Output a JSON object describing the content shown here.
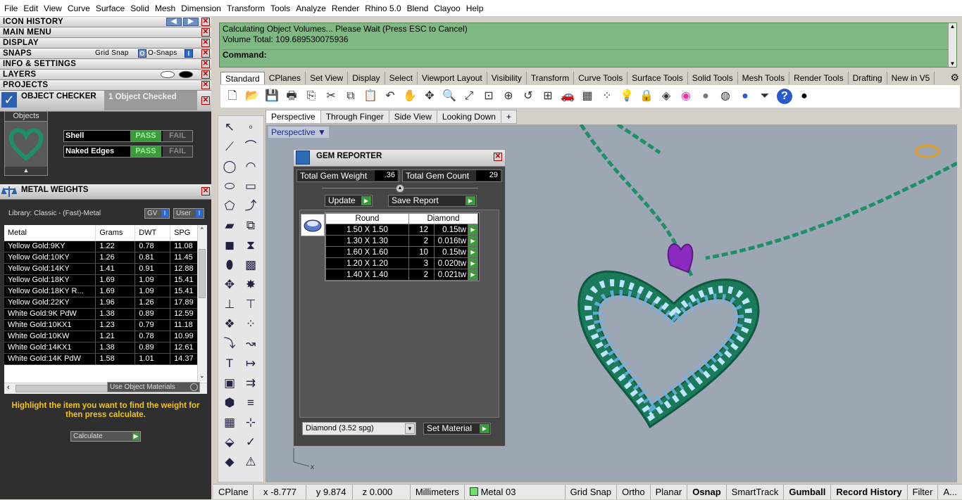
{
  "menu": [
    "File",
    "Edit",
    "View",
    "Curve",
    "Surface",
    "Solid",
    "Mesh",
    "Dimension",
    "Transform",
    "Tools",
    "Analyze",
    "Render",
    "Rhino 5.0",
    "Blend",
    "Clayoo",
    "Help"
  ],
  "left_sections": {
    "icon_history": "ICON HISTORY",
    "main_menu": "MAIN MENU",
    "display": "DISPLAY",
    "snaps": "SNAPS",
    "grid_snap": "Grid Snap",
    "osnaps": "O-Snaps",
    "info_settings": "INFO & SETTINGS",
    "layers": "LAYERS",
    "projects": "PROJECTS"
  },
  "object_checker": {
    "title": "OBJECT CHECKER",
    "status": "1  Object Checked",
    "objects_label": "Objects",
    "checks": [
      {
        "name": "Shell",
        "pass": "PASS",
        "fail": "FAIL"
      },
      {
        "name": "Naked Edges",
        "pass": "PASS",
        "fail": "FAIL"
      }
    ]
  },
  "metal_weights": {
    "title": "METAL WEIGHTS",
    "library": "Library: Classic - (Fast)-Metal",
    "gv": "GV",
    "user": "User",
    "columns": [
      "Metal",
      "Grams",
      "DWT",
      "SPG"
    ],
    "rows": [
      [
        "Yellow Gold:9KY",
        "1.22",
        "0.78",
        "11.08"
      ],
      [
        "Yellow Gold:10KY",
        "1.26",
        "0.81",
        "11.45"
      ],
      [
        "Yellow Gold:14KY",
        "1.41",
        "0.91",
        "12.88"
      ],
      [
        "Yellow Gold:18KY",
        "1.69",
        "1.09",
        "15.41"
      ],
      [
        "Yellow Gold:18KY R...",
        "1.69",
        "1.09",
        "15.41"
      ],
      [
        "Yellow Gold:22KY",
        "1.96",
        "1.26",
        "17.89"
      ],
      [
        "White Gold:9K PdW",
        "1.38",
        "0.89",
        "12.59"
      ],
      [
        "White Gold:10KX1",
        "1.23",
        "0.79",
        "11.18"
      ],
      [
        "White Gold:10KW",
        "1.21",
        "0.78",
        "10.99"
      ],
      [
        "White Gold:14KX1",
        "1.38",
        "0.89",
        "12.61"
      ],
      [
        "White Gold:14K PdW",
        "1.58",
        "1.01",
        "14.37"
      ]
    ],
    "use_object_materials": "Use Object Materials",
    "hint": "Highlight the item you want to find the weight for then press calculate.",
    "calculate": "Calculate"
  },
  "command": {
    "line1": "Calculating Object Volumes... Please Wait (Press ESC to Cancel)",
    "line2": "Volume Total: 109.689530075936",
    "prompt": "Command:"
  },
  "toolbar_tabs": [
    "Standard",
    "CPlanes",
    "Set View",
    "Display",
    "Select",
    "Viewport Layout",
    "Visibility",
    "Transform",
    "Curve Tools",
    "Surface Tools",
    "Solid Tools",
    "Mesh Tools",
    "Render Tools",
    "Drafting",
    "New in V5"
  ],
  "toolbar_icons": [
    "new-icon",
    "open-icon",
    "save-icon",
    "print-icon",
    "import-icon",
    "cut-icon",
    "copy-icon",
    "paste-icon",
    "undo-icon",
    "pan-icon",
    "rotate-view-icon",
    "zoom-icon",
    "zoom-extents-icon",
    "zoom-window-icon",
    "zoom-selected-icon",
    "undo-view-icon",
    "four-views-icon",
    "car-icon",
    "grid-icon",
    "points-icon",
    "light-icon",
    "lock-icon",
    "layer-icon",
    "color-wheel-icon",
    "sphere-gray-icon",
    "sphere-white-icon",
    "sphere-blue-icon",
    "filter-icon",
    "help-icon",
    "sphere-black-icon"
  ],
  "viewport_tabs": [
    "Perspective",
    "Through Finger",
    "Side View",
    "Looking Down",
    "+"
  ],
  "viewport_label": "Perspective",
  "gem_reporter": {
    "title": "GEM REPORTER",
    "total_weight_label": "Total Gem Weight",
    "total_weight": ".36",
    "total_count_label": "Total Gem Count",
    "total_count": "29",
    "update": "Update",
    "save_report": "Save Report",
    "headers": [
      "Round",
      "Diamond"
    ],
    "rows": [
      [
        "1.50 X 1.50",
        "12",
        "0.15tw"
      ],
      [
        "1.30 X 1.30",
        "2",
        "0.016tw"
      ],
      [
        "1.60 X 1.60",
        "10",
        "0.15tw"
      ],
      [
        "1.20 X 1.20",
        "3",
        "0.020tw"
      ],
      [
        "1.40 X 1.40",
        "2",
        "0.021tw"
      ]
    ],
    "material": "Diamond     (3.52 spg)",
    "set_material": "Set Material"
  },
  "status": {
    "cplane": "CPlane",
    "x": "x -8.777",
    "y": "y 9.874",
    "z": "z 0.000",
    "units": "Millimeters",
    "layer": "Metal 03",
    "toggles": [
      "Grid Snap",
      "Ortho",
      "Planar",
      "Osnap",
      "SmartTrack",
      "Gumball",
      "Record History",
      "Filter",
      "A..."
    ]
  },
  "colors": {
    "command_bg": "#7fb883",
    "pass": "#3c9a3c",
    "metal_green": "#1f8f6a",
    "gem_blue": "#6fb4e6",
    "bail_purple": "#8a2ac0",
    "hint": "#f0c419"
  }
}
